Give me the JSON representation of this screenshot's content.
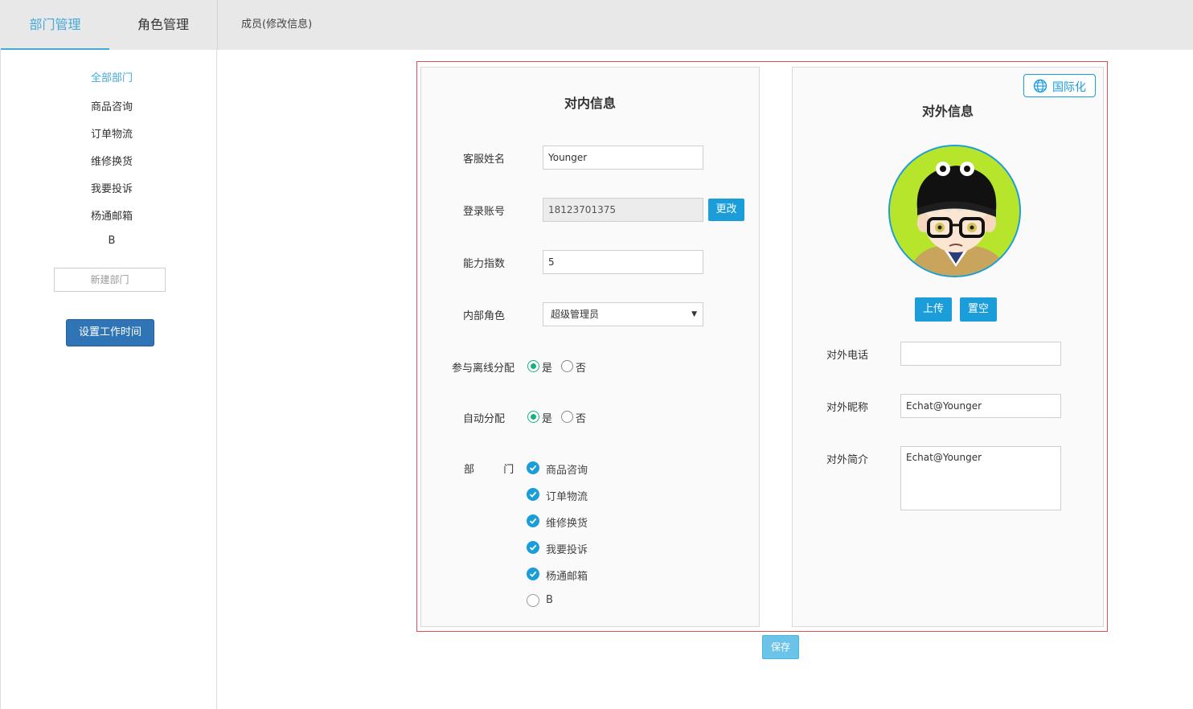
{
  "header": {
    "tabs": [
      {
        "label": "部门管理",
        "active": true
      },
      {
        "label": "角色管理",
        "active": false
      }
    ],
    "breadcrumb": "成员(修改信息)"
  },
  "sidebar": {
    "departments": [
      "全部部门",
      "商品咨询",
      "订单物流",
      "维修换货",
      "我要投诉",
      "杨通邮箱",
      "B"
    ],
    "active_index": 0,
    "new_dept_placeholder": "新建部门",
    "worktime_button": "设置工作时间"
  },
  "internal": {
    "title": "对内信息",
    "name_label": "客服姓名",
    "name_value": "Younger",
    "account_label": "登录账号",
    "account_value": "18123701375",
    "change_button": "更改",
    "ability_label": "能力指数",
    "ability_value": "5",
    "role_label": "内部角色",
    "role_value": "超级管理员",
    "offline_label": "参与离线分配",
    "offline_value": "是",
    "auto_label": "自动分配",
    "auto_value": "是",
    "yes_label": "是",
    "no_label": "否",
    "dept_label": "部  门",
    "dept_checks": [
      {
        "label": "商品咨询",
        "checked": true
      },
      {
        "label": "订单物流",
        "checked": true
      },
      {
        "label": "维修换货",
        "checked": true
      },
      {
        "label": "我要投诉",
        "checked": true
      },
      {
        "label": "杨通邮箱",
        "checked": true
      },
      {
        "label": "B",
        "checked": false
      }
    ]
  },
  "external": {
    "title": "对外信息",
    "intl_button": "国际化",
    "upload_button": "上传",
    "clear_button": "置空",
    "phone_label": "对外电话",
    "phone_value": "",
    "nickname_label": "对外昵称",
    "nickname_value": "Echat@Younger",
    "intro_label": "对外简介",
    "intro_value": "Echat@Younger"
  },
  "save_button": "保存",
  "colors": {
    "accent": "#1a9dd9",
    "tab_active": "#45a9db",
    "radio_on": "#19b07e",
    "frame_border": "#d9534f",
    "worktime_button": "#2f74b5"
  },
  "icons": {
    "intl": "globe-icon",
    "check": "checkmark-icon",
    "select": "caret-down-icon"
  }
}
